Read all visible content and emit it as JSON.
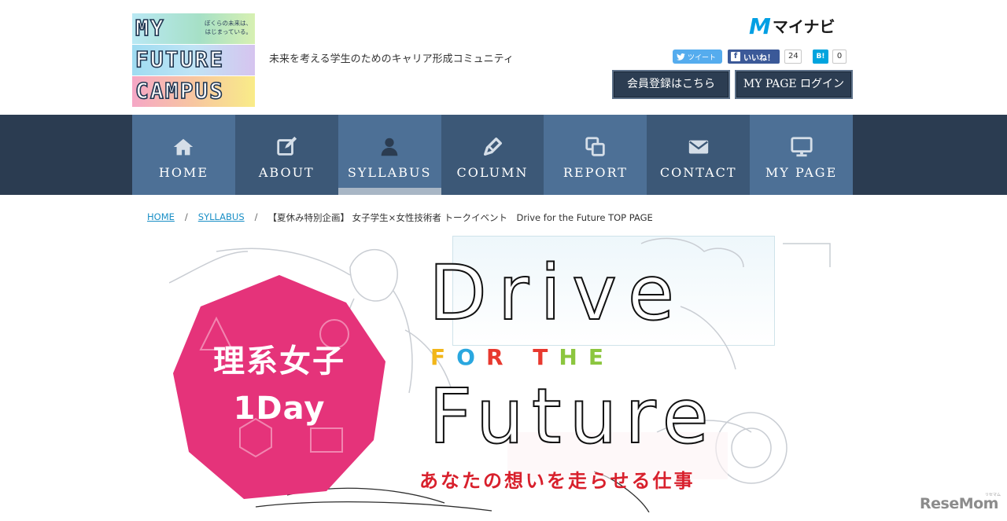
{
  "site": {
    "logo": {
      "line1": "MY",
      "line2": "FUTURE",
      "line3": "CAMPUS",
      "tag": "ぼくらの未来は、はじまっている。"
    },
    "tagline": "未来を考える学生のためのキャリア形成コミュニティ",
    "brand": {
      "mark": "M",
      "name": "マイナビ"
    },
    "social": {
      "tweet_label": "ツイート",
      "like_label": "いいね！",
      "like_count": "24",
      "hatena_label": "B!",
      "hatena_count": "0"
    },
    "buttons": {
      "register": "会員登録はこちら",
      "login": "MY PAGE ログイン"
    }
  },
  "nav": {
    "items": [
      {
        "label": "HOME",
        "icon": "home-icon"
      },
      {
        "label": "ABOUT",
        "icon": "edit-icon"
      },
      {
        "label": "SYLLABUS",
        "icon": "person-icon",
        "active": true
      },
      {
        "label": "COLUMN",
        "icon": "pen-icon"
      },
      {
        "label": "REPORT",
        "icon": "copy-icon"
      },
      {
        "label": "CONTACT",
        "icon": "mail-icon"
      },
      {
        "label": "MY PAGE",
        "icon": "monitor-icon"
      }
    ]
  },
  "breadcrumb": {
    "home": "HOME",
    "syllabus": "SYLLABUS",
    "separator": "/",
    "current": "【夏休み特別企画】 女子学生×女性技術者 トークイベント　Drive for the Future TOP PAGE"
  },
  "hero": {
    "badge_line1": "理系女子",
    "badge_line2": "1Day",
    "title_line1": "Drive",
    "for_the": [
      "F",
      "O",
      "R",
      " ",
      "T",
      "H",
      "E"
    ],
    "for_the_colors": [
      "#f2b619",
      "#2aa7df",
      "#e8392f",
      "",
      "#e8392f",
      "#8cc63f",
      "#8cc63f"
    ],
    "title_line2": "Future",
    "subtitle": "あなたの想いを走らせる仕事"
  },
  "watermark": {
    "text": "ReseMom",
    "small": "リセマム"
  },
  "colors": {
    "nav_bg": "#2b3c51",
    "nav_light": "#4d7096",
    "nav_dark": "#3c5877",
    "badge_pink": "#e5337a",
    "subtitle_red": "#d8202c",
    "brand_blue": "#009fe3"
  }
}
